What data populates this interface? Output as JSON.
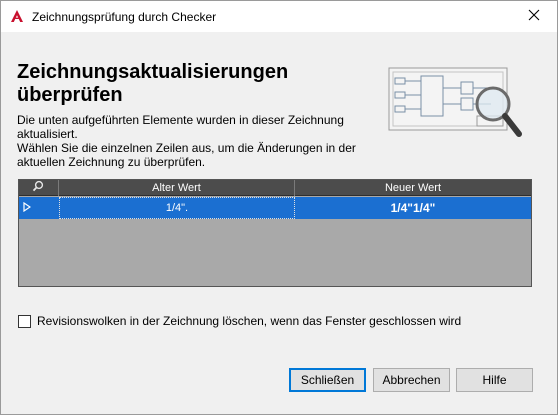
{
  "window": {
    "title": "Zeichnungsprüfung durch Checker",
    "icon": "autocad-a-icon",
    "close_icon": "close-icon"
  },
  "heading": {
    "line1": "Zeichnungsaktualisierungen",
    "line2": "überprüfen"
  },
  "description": {
    "line1": "Die unten aufgeführten Elemente wurden in dieser Zeichnung aktualisiert.",
    "line2": "Wählen Sie die einzelnen Zeilen aus, um die Änderungen in der aktuellen Zeichnung zu überprüfen."
  },
  "illustration": {
    "icon": "drawing-magnifier-icon"
  },
  "grid": {
    "columns": {
      "icon": "zoom-search-icon",
      "old": "Alter Wert",
      "new": "Neuer Wert"
    },
    "rows": [
      {
        "old": "1/4\".",
        "new": "1/4\"1/4\"",
        "selected": true
      }
    ]
  },
  "checkbox": {
    "label": "Revisionswolken in der Zeichnung löschen, wenn das Fenster geschlossen wird",
    "checked": false
  },
  "buttons": {
    "close": "Schließen",
    "cancel": "Abbrechen",
    "help": "Hilfe"
  },
  "colors": {
    "selection": "#1b6fd1",
    "grid_header": "#4c4c4c",
    "grid_background": "#a9a9a9",
    "brand_red": "#c8102e"
  }
}
